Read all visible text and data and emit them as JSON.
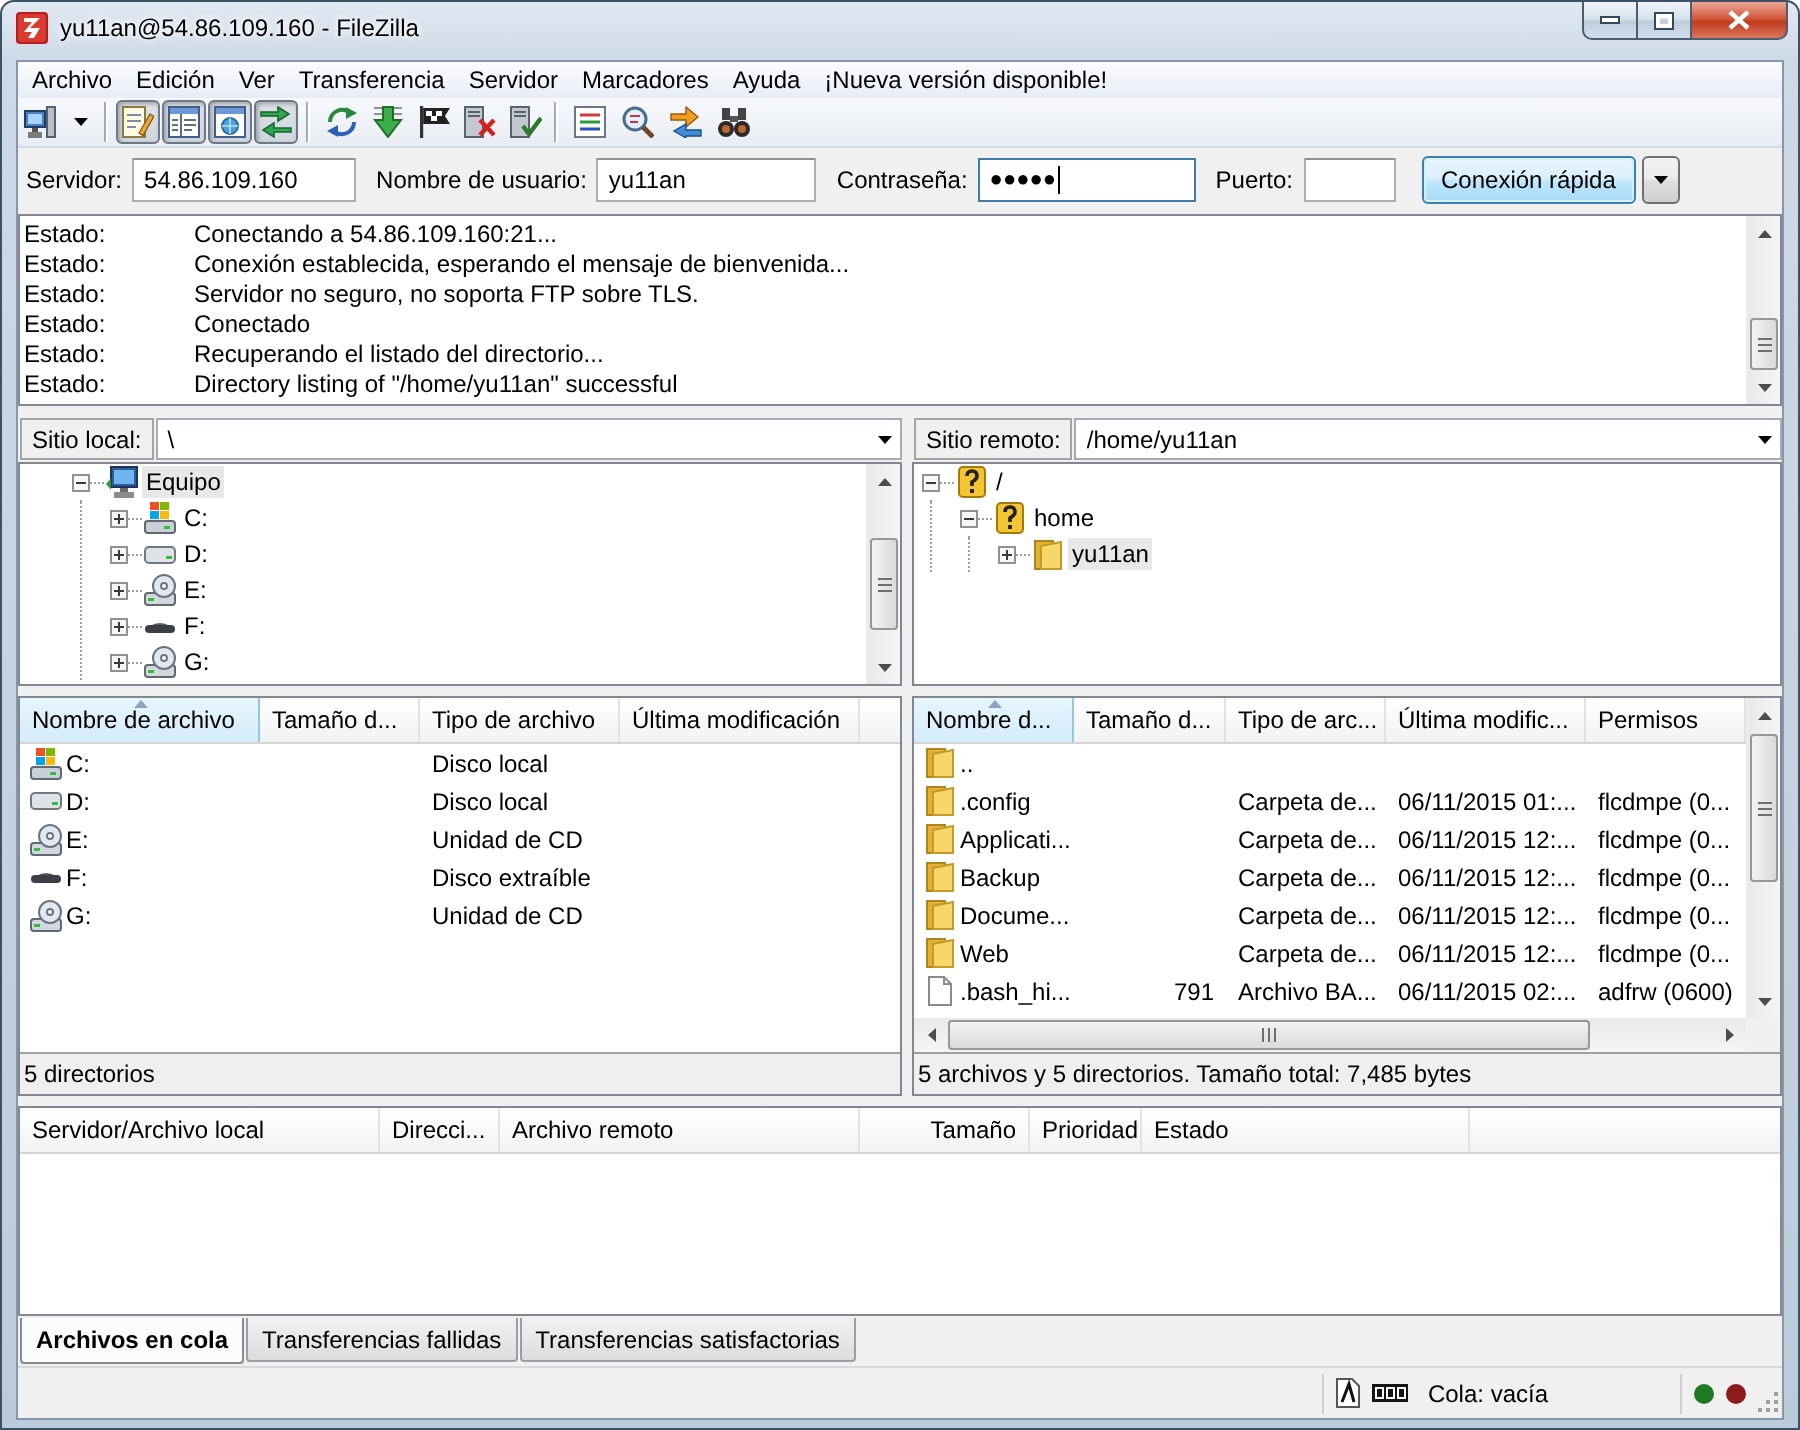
{
  "window": {
    "title": "yu11an@54.86.109.160 - FileZilla"
  },
  "menu": [
    "Archivo",
    "Edición",
    "Ver",
    "Transferencia",
    "Servidor",
    "Marcadores",
    "Ayuda",
    "¡Nueva versión disponible!"
  ],
  "toolbar": {
    "toggles": [
      {
        "on": true
      },
      {
        "on": true
      },
      {
        "on": true
      },
      {
        "on": true
      }
    ]
  },
  "quick_connect": {
    "fields": [
      {
        "label": "Servidor:",
        "value": "54.86.109.160",
        "focused": false
      },
      {
        "label": "Nombre de usuario:",
        "value": "yu11an",
        "focused": false
      },
      {
        "label": "Contraseña:",
        "value": "●●●●●",
        "focused": true
      },
      {
        "label": "Puerto:",
        "focused": false
      }
    ],
    "button": "Conexión rápida"
  },
  "message_log": [
    {
      "label": "Estado:",
      "text": "Conectando a 54.86.109.160:21..."
    },
    {
      "label": "Estado:",
      "text": "Conexión establecida, esperando el mensaje de bienvenida..."
    },
    {
      "label": "Estado:",
      "text": "Servidor no seguro, no soporta FTP sobre TLS."
    },
    {
      "label": "Estado:",
      "text": "Conectado"
    },
    {
      "label": "Estado:",
      "text": "Recuperando el listado del directorio..."
    },
    {
      "label": "Estado:",
      "text": "Directory listing of \"/home/yu11an\" successful"
    }
  ],
  "local_site": {
    "label": "Sitio local:",
    "path": "\\",
    "tree": [
      {
        "label": "Equipo",
        "kind": "computer",
        "expanded": true,
        "selected": true,
        "children": [
          {
            "label": "C:",
            "kind": "system_drive",
            "expanded": false,
            "selected": false
          },
          {
            "label": "D:",
            "kind": "disk",
            "expanded": false,
            "selected": false
          },
          {
            "label": "E:",
            "kind": "cd",
            "expanded": false,
            "selected": false
          },
          {
            "label": "F:",
            "kind": "removable",
            "expanded": false,
            "selected": false
          },
          {
            "label": "G:",
            "kind": "cd",
            "expanded": false,
            "selected": false
          }
        ]
      }
    ]
  },
  "remote_site": {
    "label": "Sitio remoto:",
    "path": "/home/yu11an",
    "tree": [
      {
        "label": "/",
        "kind": "unknown",
        "expanded": true,
        "selected": false,
        "children": [
          {
            "label": "home",
            "kind": "unknown",
            "expanded": true,
            "selected": false,
            "children": [
              {
                "label": "yu11an",
                "kind": "folder",
                "expanded": false,
                "selected": true
              }
            ]
          }
        ]
      }
    ]
  },
  "local_files": {
    "columns": [
      {
        "label": "Nombre de archivo",
        "sorted": true
      },
      {
        "label": "Tamaño d...",
        "sorted": false
      },
      {
        "label": "Tipo de archivo",
        "sorted": false
      },
      {
        "label": "Última modificación",
        "sorted": false
      }
    ],
    "rows": [
      {
        "kind": "system_drive",
        "name": "C:",
        "type": "Disco local"
      },
      {
        "kind": "disk",
        "name": "D:",
        "type": "Disco local"
      },
      {
        "kind": "cd",
        "name": "E:",
        "type": "Unidad de CD"
      },
      {
        "kind": "removable",
        "name": "F:",
        "type": "Disco extraíble"
      },
      {
        "kind": "cd",
        "name": "G:",
        "type": "Unidad de CD"
      }
    ],
    "status": "5 directorios"
  },
  "remote_files": {
    "columns": [
      {
        "label": "Nombre d...",
        "sorted": true
      },
      {
        "label": "Tamaño d...",
        "sorted": false
      },
      {
        "label": "Tipo de arc...",
        "sorted": false
      },
      {
        "label": "Última modific...",
        "sorted": false
      },
      {
        "label": "Permisos",
        "sorted": false
      }
    ],
    "rows": [
      {
        "kind": "folder",
        "name": ".."
      },
      {
        "kind": "folder",
        "name": ".config",
        "type": "Carpeta de...",
        "modified": "06/11/2015 01:...",
        "permissions": "flcdmpe (0..."
      },
      {
        "kind": "folder",
        "name": "Applicati...",
        "type": "Carpeta de...",
        "modified": "06/11/2015 12:...",
        "permissions": "flcdmpe (0..."
      },
      {
        "kind": "folder",
        "name": "Backup",
        "type": "Carpeta de...",
        "modified": "06/11/2015 12:...",
        "permissions": "flcdmpe (0..."
      },
      {
        "kind": "folder",
        "name": "Docume...",
        "type": "Carpeta de...",
        "modified": "06/11/2015 12:...",
        "permissions": "flcdmpe (0..."
      },
      {
        "kind": "folder",
        "name": "Web",
        "type": "Carpeta de...",
        "modified": "06/11/2015 12:...",
        "permissions": "flcdmpe (0..."
      },
      {
        "kind": "file",
        "name": ".bash_hi...",
        "size": "791",
        "type": "Archivo BA...",
        "modified": "06/11/2015 02:...",
        "permissions": "adfrw (0600)"
      }
    ],
    "status": "5 archivos y 5 directorios. Tamaño total: 7,485 bytes"
  },
  "queue": {
    "columns": [
      "Servidor/Archivo local",
      "Direcci...",
      "Archivo remoto",
      "Tamaño",
      "Prioridad",
      "Estado"
    ]
  },
  "queue_tabs": [
    {
      "label": "Archivos en cola",
      "selected": true
    },
    {
      "label": "Transferencias fallidas",
      "selected": false
    },
    {
      "label": "Transferencias satisfactorias",
      "selected": false
    }
  ],
  "status_bar": {
    "queue": "Cola: vacía",
    "indicators": [
      {
        "color": "#1f7a24"
      },
      {
        "color": "#8e1b1b"
      }
    ]
  }
}
